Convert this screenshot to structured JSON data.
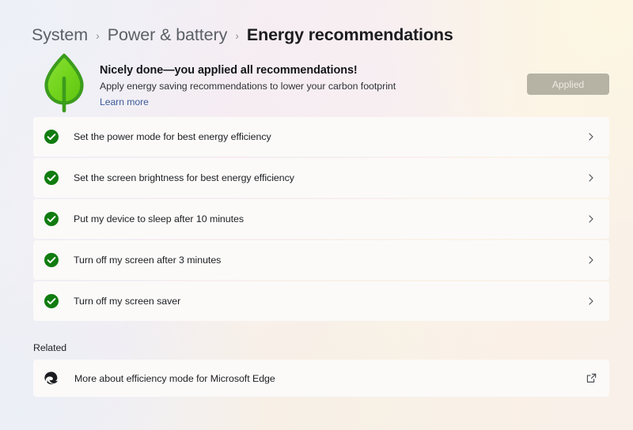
{
  "breadcrumb": {
    "items": [
      {
        "label": "System",
        "current": false
      },
      {
        "label": "Power & battery",
        "current": false
      },
      {
        "label": "Energy recommendations",
        "current": true
      }
    ],
    "separator": "›"
  },
  "hero": {
    "icon": "leaf-icon",
    "title": "Nicely done—you applied all recommendations!",
    "subtitle": "Apply energy saving recommendations to lower your carbon footprint",
    "link_label": "Learn more",
    "action_button": {
      "label": "Applied",
      "disabled": true,
      "bg_color": "#b6b3a5",
      "text_color": "#edeae0"
    }
  },
  "recommendations": {
    "status_icon": "check-circle-icon",
    "status_color": "#107c10",
    "chevron_icon": "chevron-right-icon",
    "items": [
      {
        "label": "Set the power mode for best energy efficiency",
        "applied": true
      },
      {
        "label": "Set the screen brightness for best energy efficiency",
        "applied": true
      },
      {
        "label": "Put my device to sleep after 10 minutes",
        "applied": true
      },
      {
        "label": "Turn off my screen after 3 minutes",
        "applied": true
      },
      {
        "label": "Turn off my screen saver",
        "applied": true
      }
    ]
  },
  "related": {
    "heading": "Related",
    "items": [
      {
        "label": "More about efficiency mode for Microsoft Edge",
        "icon": "microsoft-edge-icon",
        "trailing_icon": "open-in-new-window-icon"
      }
    ]
  },
  "theme": {
    "card_bg": "#fbfaf9",
    "link_color": "#3d5a98",
    "text_primary": "#1d1f23",
    "text_secondary": "#5b5f66",
    "leaf_fill": "#6fd318",
    "leaf_outline": "#3c9c1d"
  }
}
